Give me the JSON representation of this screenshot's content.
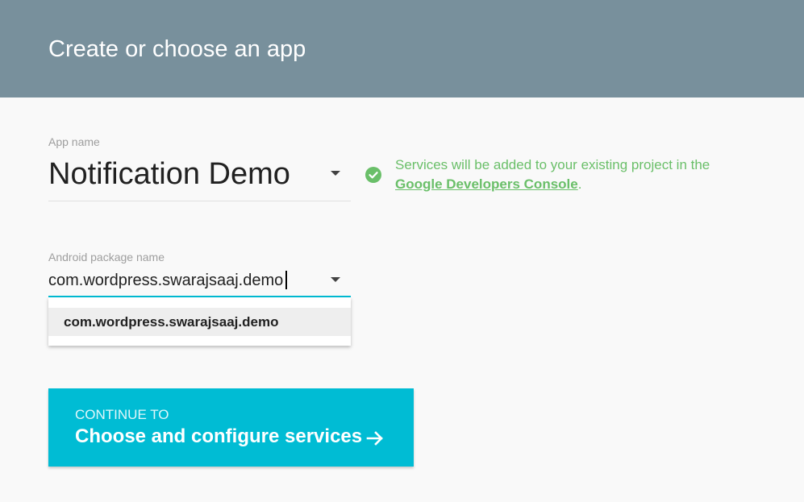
{
  "header": {
    "title": "Create or choose an app"
  },
  "app_name": {
    "label": "App name",
    "value": "Notification Demo",
    "dropdown_icon": "caret-down-icon"
  },
  "info": {
    "icon": "check-circle-icon",
    "text_prefix": "Services will be added to your existing project in the ",
    "link_text": "Google Developers Console",
    "text_suffix": "."
  },
  "package": {
    "label": "Android package name",
    "value": "com.wordpress.swarajsaaj.demo",
    "dropdown_icon": "caret-down-icon",
    "suggestions": [
      "com.wordpress.swarajsaaj.demo"
    ]
  },
  "continue_button": {
    "eyebrow": "CONTINUE TO",
    "label": "Choose and configure services",
    "icon": "arrow-right-icon"
  },
  "colors": {
    "header_bg": "#78909c",
    "accent": "#00bcd4",
    "success": "#6abf69",
    "page_bg": "#f9f9f9"
  }
}
